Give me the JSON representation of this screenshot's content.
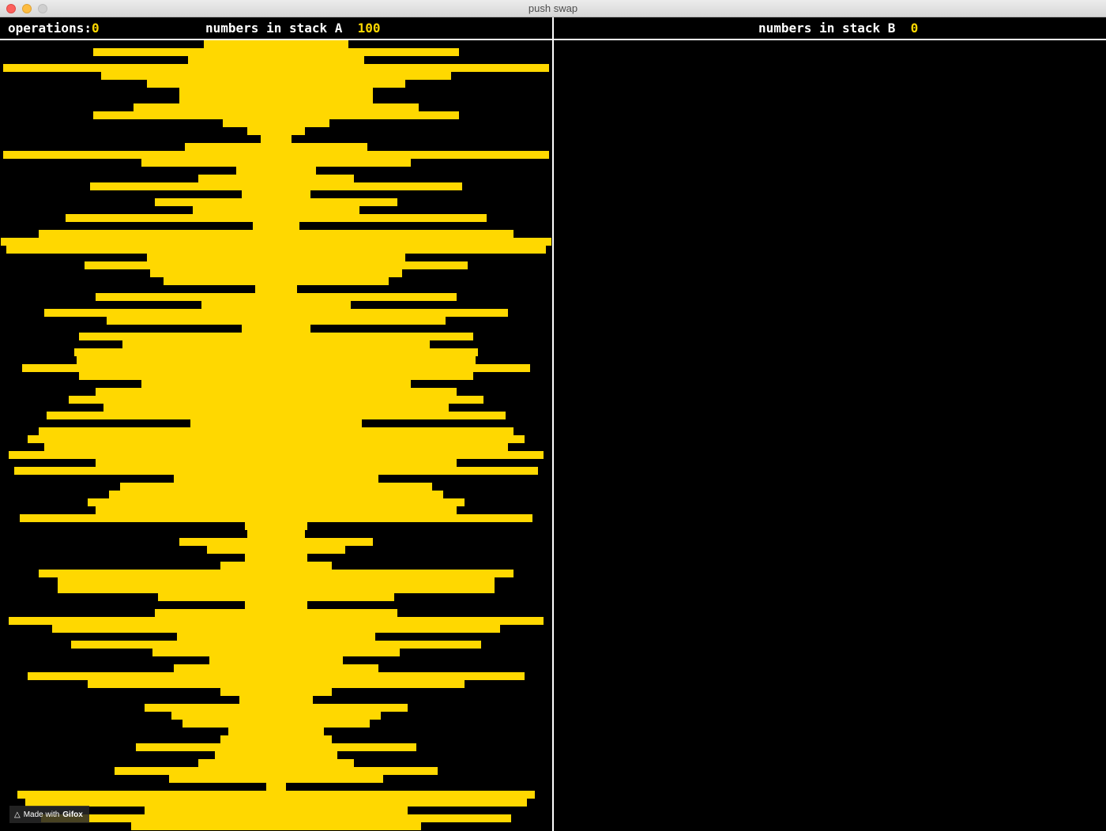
{
  "window": {
    "title": "push swap"
  },
  "header": {
    "operations_label": "operations:",
    "operations_value": "0",
    "stack_a_label": "numbers in stack A",
    "stack_a_count": "100",
    "stack_b_label": "numbers in stack B",
    "stack_b_count": "0"
  },
  "colors": {
    "bar": "#ffd800",
    "background": "#000000",
    "divider": "#ffffff"
  },
  "badge": {
    "prefix": "Made with",
    "brand": "Gifox",
    "icon": "fox-icon"
  },
  "stack_a": [
    25,
    66,
    31,
    99,
    63,
    46,
    34,
    34,
    51,
    66,
    18,
    9,
    4,
    32,
    99,
    48,
    13,
    27,
    67,
    11,
    43,
    29,
    76,
    7,
    86,
    100,
    98,
    46,
    69,
    45,
    40,
    6,
    65,
    26,
    84,
    61,
    11,
    71,
    55,
    73,
    72,
    92,
    71,
    48,
    65,
    75,
    62,
    83,
    30,
    86,
    90,
    84,
    97,
    65,
    95,
    36,
    56,
    60,
    68,
    65,
    93,
    10,
    9,
    34,
    24,
    10,
    19,
    86,
    79,
    79,
    42,
    10,
    43,
    97,
    81,
    35,
    74,
    44,
    23,
    36,
    90,
    68,
    19,
    12,
    47,
    37,
    33,
    16,
    19,
    50,
    21,
    27,
    58,
    38,
    2,
    94,
    91,
    47,
    85,
    52
  ],
  "stack_b": []
}
